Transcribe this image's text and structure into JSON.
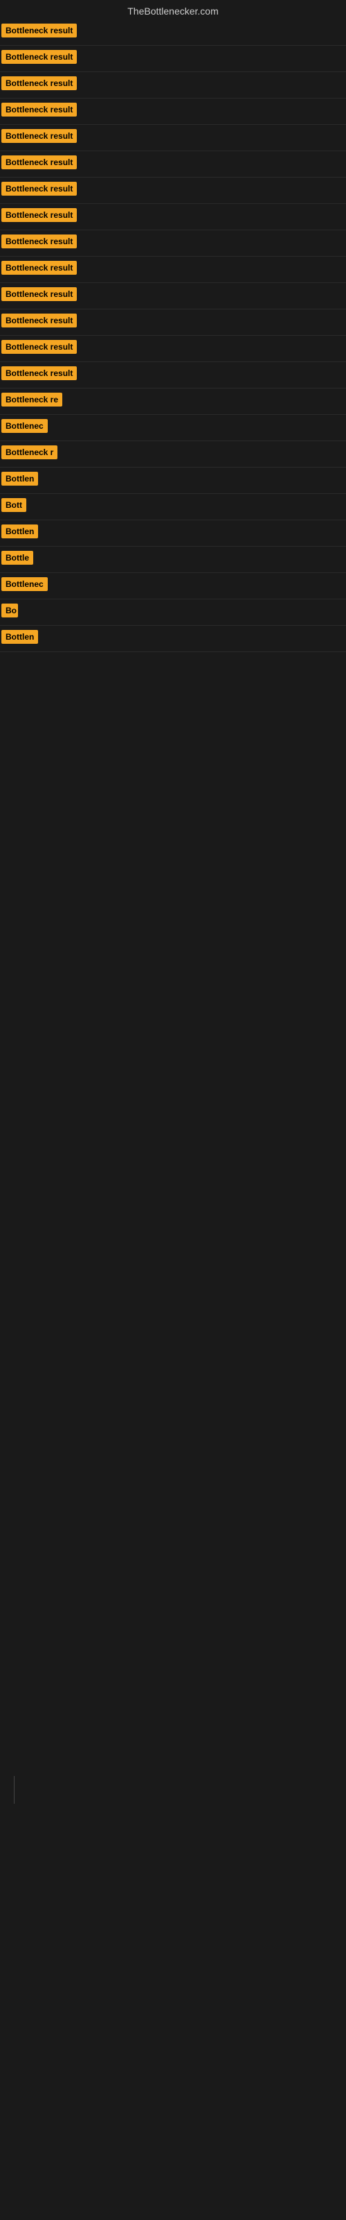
{
  "header": {
    "site_title": "TheBottlenecker.com"
  },
  "results": [
    {
      "id": 1,
      "label": "Bottleneck result",
      "width": 110
    },
    {
      "id": 2,
      "label": "Bottleneck result",
      "width": 110
    },
    {
      "id": 3,
      "label": "Bottleneck result",
      "width": 110
    },
    {
      "id": 4,
      "label": "Bottleneck result",
      "width": 110
    },
    {
      "id": 5,
      "label": "Bottleneck result",
      "width": 110
    },
    {
      "id": 6,
      "label": "Bottleneck result",
      "width": 110
    },
    {
      "id": 7,
      "label": "Bottleneck result",
      "width": 110
    },
    {
      "id": 8,
      "label": "Bottleneck result",
      "width": 110
    },
    {
      "id": 9,
      "label": "Bottleneck result",
      "width": 110
    },
    {
      "id": 10,
      "label": "Bottleneck result",
      "width": 110
    },
    {
      "id": 11,
      "label": "Bottleneck result",
      "width": 110
    },
    {
      "id": 12,
      "label": "Bottleneck result",
      "width": 110
    },
    {
      "id": 13,
      "label": "Bottleneck result",
      "width": 110
    },
    {
      "id": 14,
      "label": "Bottleneck result",
      "width": 110
    },
    {
      "id": 15,
      "label": "Bottleneck re",
      "width": 90
    },
    {
      "id": 16,
      "label": "Bottlenec",
      "width": 72
    },
    {
      "id": 17,
      "label": "Bottleneck r",
      "width": 82
    },
    {
      "id": 18,
      "label": "Bottlen",
      "width": 58
    },
    {
      "id": 19,
      "label": "Bott",
      "width": 38
    },
    {
      "id": 20,
      "label": "Bottlen",
      "width": 58
    },
    {
      "id": 21,
      "label": "Bottle",
      "width": 50
    },
    {
      "id": 22,
      "label": "Bottlenec",
      "width": 72
    },
    {
      "id": 23,
      "label": "Bo",
      "width": 24
    },
    {
      "id": 24,
      "label": "Bottlen",
      "width": 58
    }
  ]
}
